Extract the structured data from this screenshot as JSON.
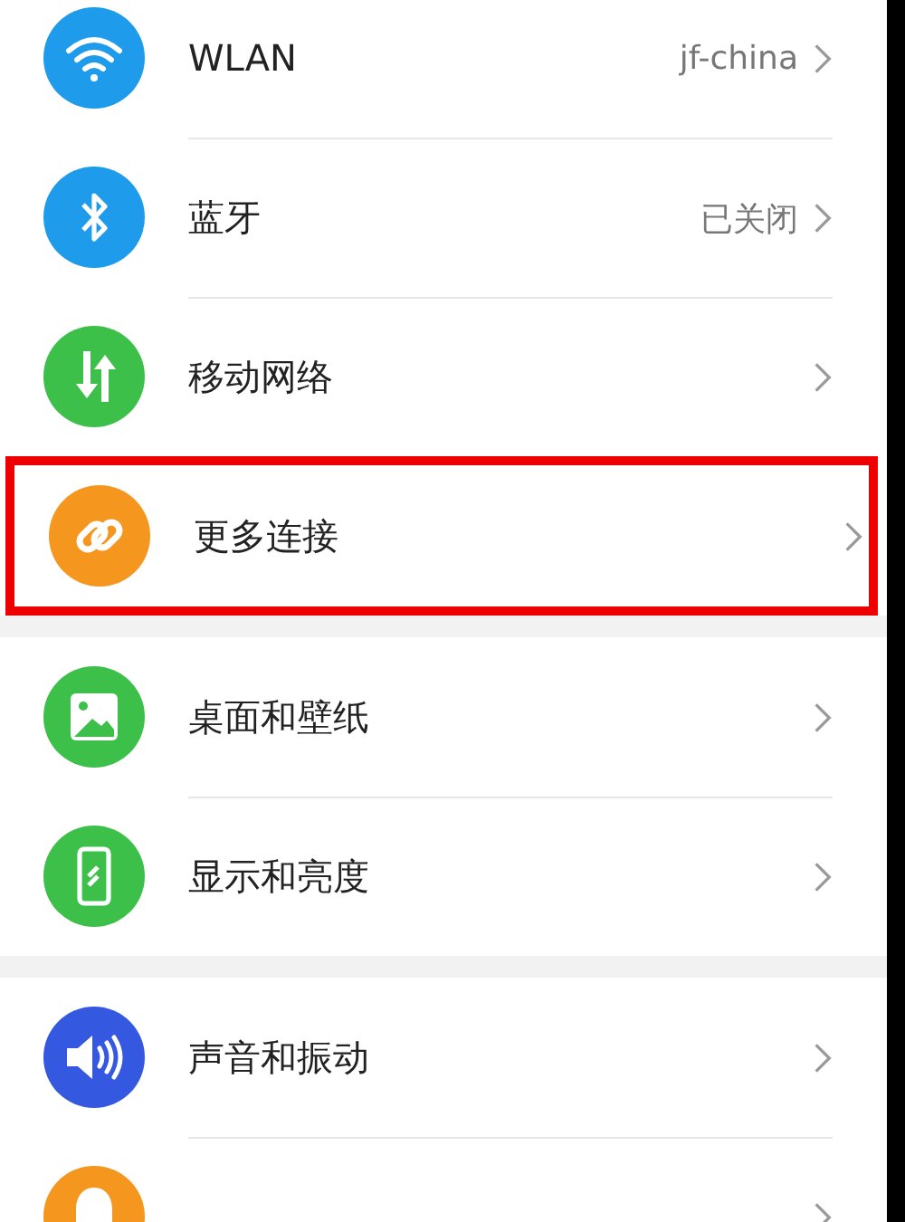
{
  "groups": [
    {
      "items": [
        {
          "kind": "wifi",
          "color": "#1e9bea",
          "label": "WLAN",
          "value": "jf-china",
          "highlighted": false
        },
        {
          "kind": "bluetooth",
          "color": "#1e9bea",
          "label": "蓝牙",
          "value": "已关闭",
          "highlighted": false
        },
        {
          "kind": "arrows",
          "color": "#3cc04a",
          "label": "移动网络",
          "highlighted": false
        },
        {
          "kind": "link",
          "color": "#f5961e",
          "label": "更多连接",
          "highlighted": true
        }
      ]
    },
    {
      "items": [
        {
          "kind": "image",
          "color": "#3cc04a",
          "label": "桌面和壁纸",
          "highlighted": false
        },
        {
          "kind": "phone",
          "color": "#3cc04a",
          "label": "显示和亮度",
          "highlighted": false
        }
      ]
    },
    {
      "items": [
        {
          "kind": "speaker",
          "color": "#3558e0",
          "label": "声音和振动",
          "highlighted": false
        },
        {
          "kind": "bell",
          "color": "#f5961e",
          "highlighted": false
        }
      ]
    }
  ]
}
